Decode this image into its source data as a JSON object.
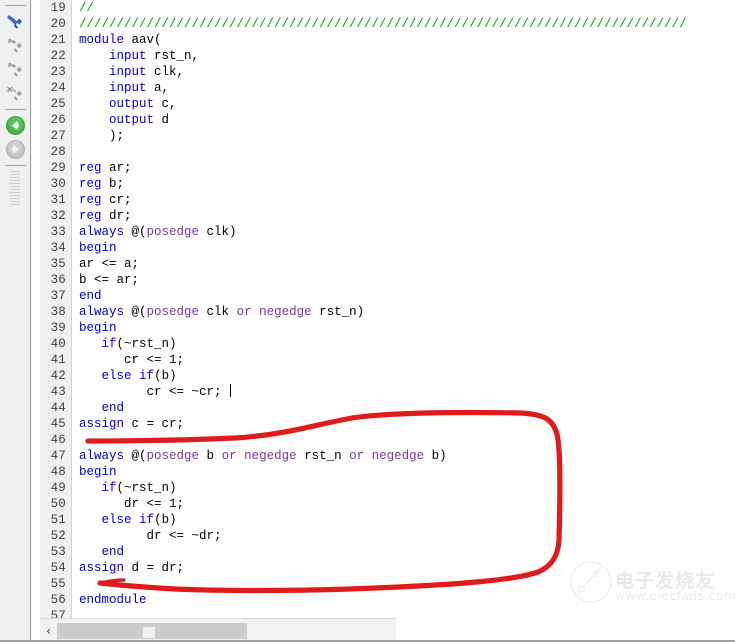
{
  "toolbar": {
    "items": [
      {
        "name": "bookmark-toggle-icon",
        "label": "Toggle Bookmark",
        "state": "enabled"
      },
      {
        "name": "bookmark-next-icon",
        "label": "Next Bookmark",
        "state": "disabled"
      },
      {
        "name": "bookmark-prev-icon",
        "label": "Previous Bookmark",
        "state": "disabled"
      },
      {
        "name": "bookmark-clear-icon",
        "label": "Clear All Bookmarks",
        "state": "disabled"
      },
      {
        "name": "navigate-back-icon",
        "label": "Back",
        "state": "enabled"
      },
      {
        "name": "navigate-forward-icon",
        "label": "Forward",
        "state": "disabled"
      }
    ]
  },
  "editor": {
    "language": "verilog",
    "first_visible_line": 19,
    "last_visible_line": 57,
    "cursor_line": 43,
    "colors": {
      "keyword": "#0000c0",
      "keyword_alt": "#7a36a6",
      "comment": "#13a313",
      "text": "#000000",
      "gutter_bg": "#f0f0f0",
      "editor_bg": "#ffffff",
      "annotation": "#e01b1b"
    },
    "lines": [
      {
        "n": 19,
        "tokens": [
          {
            "t": "//",
            "c": "cm"
          }
        ]
      },
      {
        "n": 20,
        "tokens": [
          {
            "t": "/////////////////////////////////////////////////////////////////////////////////",
            "c": "cm"
          }
        ]
      },
      {
        "n": 21,
        "tokens": [
          {
            "t": "module",
            "c": "kw"
          },
          {
            "t": " aav(",
            "c": "txt"
          }
        ]
      },
      {
        "n": 22,
        "tokens": [
          {
            "t": "    ",
            "c": "txt"
          },
          {
            "t": "input",
            "c": "kw"
          },
          {
            "t": " rst_n,",
            "c": "txt"
          }
        ]
      },
      {
        "n": 23,
        "tokens": [
          {
            "t": "    ",
            "c": "txt"
          },
          {
            "t": "input",
            "c": "kw"
          },
          {
            "t": " clk,",
            "c": "txt"
          }
        ]
      },
      {
        "n": 24,
        "tokens": [
          {
            "t": "    ",
            "c": "txt"
          },
          {
            "t": "input",
            "c": "kw"
          },
          {
            "t": " a,",
            "c": "txt"
          }
        ]
      },
      {
        "n": 25,
        "tokens": [
          {
            "t": "    ",
            "c": "txt"
          },
          {
            "t": "output",
            "c": "kw"
          },
          {
            "t": " c,",
            "c": "txt"
          }
        ]
      },
      {
        "n": 26,
        "tokens": [
          {
            "t": "    ",
            "c": "txt"
          },
          {
            "t": "output",
            "c": "kw"
          },
          {
            "t": " d",
            "c": "txt"
          }
        ]
      },
      {
        "n": 27,
        "tokens": [
          {
            "t": "    );",
            "c": "txt"
          }
        ]
      },
      {
        "n": 28,
        "tokens": []
      },
      {
        "n": 29,
        "tokens": [
          {
            "t": "reg",
            "c": "kw"
          },
          {
            "t": " ar;",
            "c": "txt"
          }
        ]
      },
      {
        "n": 30,
        "tokens": [
          {
            "t": "reg",
            "c": "kw"
          },
          {
            "t": " b;",
            "c": "txt"
          }
        ]
      },
      {
        "n": 31,
        "tokens": [
          {
            "t": "reg",
            "c": "kw"
          },
          {
            "t": " cr;",
            "c": "txt"
          }
        ]
      },
      {
        "n": 32,
        "tokens": [
          {
            "t": "reg",
            "c": "kw"
          },
          {
            "t": " dr;",
            "c": "txt"
          }
        ]
      },
      {
        "n": 33,
        "tokens": [
          {
            "t": "always",
            "c": "kw"
          },
          {
            "t": " @(",
            "c": "txt"
          },
          {
            "t": "posedge",
            "c": "kw2"
          },
          {
            "t": " clk)",
            "c": "txt"
          }
        ]
      },
      {
        "n": 34,
        "tokens": [
          {
            "t": "begin",
            "c": "kw"
          }
        ]
      },
      {
        "n": 35,
        "tokens": [
          {
            "t": "ar <= a;",
            "c": "txt"
          }
        ]
      },
      {
        "n": 36,
        "tokens": [
          {
            "t": "b <= ar;",
            "c": "txt"
          }
        ]
      },
      {
        "n": 37,
        "tokens": [
          {
            "t": "end",
            "c": "kw"
          }
        ]
      },
      {
        "n": 38,
        "tokens": [
          {
            "t": "always",
            "c": "kw"
          },
          {
            "t": " @(",
            "c": "txt"
          },
          {
            "t": "posedge",
            "c": "kw2"
          },
          {
            "t": " clk ",
            "c": "txt"
          },
          {
            "t": "or",
            "c": "kw2"
          },
          {
            "t": " ",
            "c": "txt"
          },
          {
            "t": "negedge",
            "c": "kw2"
          },
          {
            "t": " rst_n)",
            "c": "txt"
          }
        ]
      },
      {
        "n": 39,
        "tokens": [
          {
            "t": "begin",
            "c": "kw"
          }
        ]
      },
      {
        "n": 40,
        "tokens": [
          {
            "t": "   ",
            "c": "txt"
          },
          {
            "t": "if",
            "c": "kw"
          },
          {
            "t": "(~rst_n)",
            "c": "txt"
          }
        ]
      },
      {
        "n": 41,
        "tokens": [
          {
            "t": "      cr <= 1;",
            "c": "txt"
          }
        ]
      },
      {
        "n": 42,
        "tokens": [
          {
            "t": "   ",
            "c": "txt"
          },
          {
            "t": "else",
            "c": "kw"
          },
          {
            "t": " ",
            "c": "txt"
          },
          {
            "t": "if",
            "c": "kw"
          },
          {
            "t": "(b)",
            "c": "txt"
          }
        ]
      },
      {
        "n": 43,
        "tokens": [
          {
            "t": "         cr <= ~cr; ",
            "c": "txt"
          }
        ],
        "caret": true
      },
      {
        "n": 44,
        "tokens": [
          {
            "t": "   ",
            "c": "txt"
          },
          {
            "t": "end",
            "c": "kw"
          }
        ]
      },
      {
        "n": 45,
        "tokens": [
          {
            "t": "assign",
            "c": "kw"
          },
          {
            "t": " c = cr;",
            "c": "txt"
          }
        ]
      },
      {
        "n": 46,
        "tokens": []
      },
      {
        "n": 47,
        "tokens": [
          {
            "t": "always",
            "c": "kw"
          },
          {
            "t": " @(",
            "c": "txt"
          },
          {
            "t": "posedge",
            "c": "kw2"
          },
          {
            "t": " b ",
            "c": "txt"
          },
          {
            "t": "or",
            "c": "kw2"
          },
          {
            "t": " ",
            "c": "txt"
          },
          {
            "t": "negedge",
            "c": "kw2"
          },
          {
            "t": " rst_n ",
            "c": "txt"
          },
          {
            "t": "or",
            "c": "kw2"
          },
          {
            "t": " ",
            "c": "txt"
          },
          {
            "t": "negedge",
            "c": "kw2"
          },
          {
            "t": " b)",
            "c": "txt"
          }
        ]
      },
      {
        "n": 48,
        "tokens": [
          {
            "t": "begin",
            "c": "kw"
          }
        ]
      },
      {
        "n": 49,
        "tokens": [
          {
            "t": "   ",
            "c": "txt"
          },
          {
            "t": "if",
            "c": "kw"
          },
          {
            "t": "(~rst_n)",
            "c": "txt"
          }
        ]
      },
      {
        "n": 50,
        "tokens": [
          {
            "t": "      dr <= 1;",
            "c": "txt"
          }
        ]
      },
      {
        "n": 51,
        "tokens": [
          {
            "t": "   ",
            "c": "txt"
          },
          {
            "t": "else",
            "c": "kw"
          },
          {
            "t": " ",
            "c": "txt"
          },
          {
            "t": "if",
            "c": "kw"
          },
          {
            "t": "(b)",
            "c": "txt"
          }
        ]
      },
      {
        "n": 52,
        "tokens": [
          {
            "t": "         dr <= ~dr;",
            "c": "txt"
          }
        ]
      },
      {
        "n": 53,
        "tokens": [
          {
            "t": "   ",
            "c": "txt"
          },
          {
            "t": "end",
            "c": "kw"
          }
        ]
      },
      {
        "n": 54,
        "tokens": [
          {
            "t": "assign",
            "c": "kw"
          },
          {
            "t": " d = dr;",
            "c": "txt"
          }
        ]
      },
      {
        "n": 55,
        "tokens": []
      },
      {
        "n": 56,
        "tokens": [
          {
            "t": "endmodule",
            "c": "kw"
          }
        ]
      },
      {
        "n": 57,
        "tokens": []
      }
    ]
  },
  "annotation": {
    "name": "red-hand-drawn-loop",
    "color": "#e01b1b",
    "encircles_lines": "46-56"
  },
  "scrollbar": {
    "left_arrow": "‹",
    "orientation": "horizontal"
  },
  "watermark": {
    "brand": "电子发烧友",
    "url": "www.elecfans.com"
  }
}
